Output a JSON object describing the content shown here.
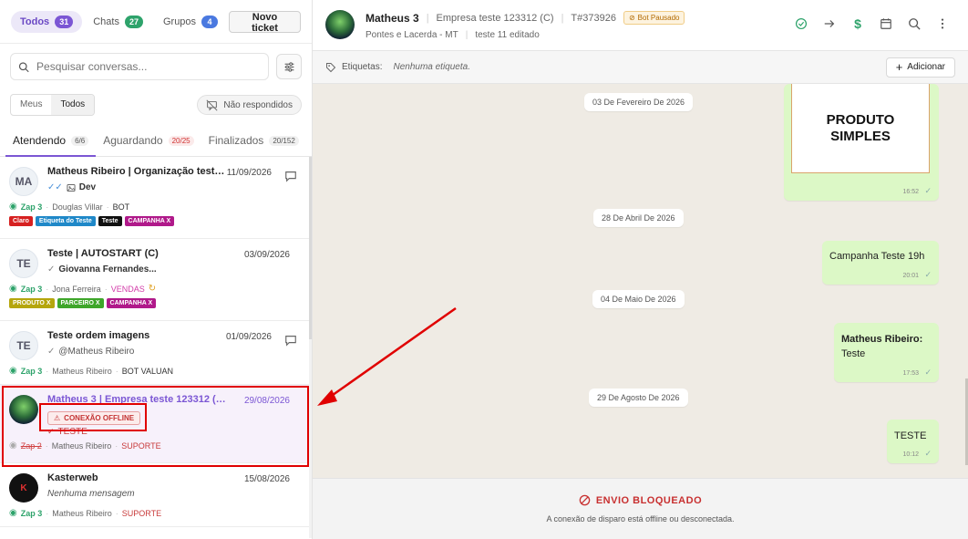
{
  "top_tabs": [
    {
      "label": "Todos",
      "count": "31"
    },
    {
      "label": "Chats",
      "count": "27"
    },
    {
      "label": "Grupos",
      "count": "4"
    }
  ],
  "new_ticket_label": "Novo ticket",
  "search": {
    "placeholder": "Pesquisar conversas..."
  },
  "segment": {
    "meus": "Meus",
    "todos": "Todos"
  },
  "nao_respondidos": "Não respondidos",
  "status_tabs": [
    {
      "label": "Atendendo",
      "count": "6/6"
    },
    {
      "label": "Aguardando",
      "count": "20/25"
    },
    {
      "label": "Finalizados",
      "count": "20/152"
    }
  ],
  "tickets": [
    {
      "initials": "MA",
      "title": "Matheus Ribeiro | Organização teste (C)",
      "date": "11/09/2026",
      "last_message": "Dev",
      "connection": "Zap 3",
      "user": "Douglas Villar",
      "queue": "BOT",
      "tags": [
        {
          "label": "Claro",
          "color": "#d62020"
        },
        {
          "label": "Etiqueta do Teste",
          "color": "#1f88c8"
        },
        {
          "label": "Teste",
          "color": "#111111"
        },
        {
          "label": "CAMPANHA X",
          "color": "#b0198a"
        }
      ]
    },
    {
      "initials": "TE",
      "title": "Teste | AUTOSTART (C)",
      "date": "03/09/2026",
      "last_message": "Giovanna Fernandes...",
      "connection": "Zap 3",
      "user": "Jona Ferreira",
      "queue": "VENDAS",
      "tags": [
        {
          "label": "PRODUTO X",
          "color": "#b5a60c"
        },
        {
          "label": "PARCEIRO X",
          "color": "#3ea62a"
        },
        {
          "label": "CAMPANHA X",
          "color": "#b0198a"
        }
      ]
    },
    {
      "initials": "TE",
      "title": "Teste ordem imagens",
      "date": "01/09/2026",
      "last_message": "@Matheus Ribeiro",
      "connection": "Zap 3",
      "user": "Matheus Ribeiro",
      "queue": "BOT VALUAN"
    },
    {
      "title": "Matheus 3 | Empresa teste 123312 (C)",
      "date": "29/08/2026",
      "offline_badge": "CONEXÃO OFFLINE",
      "last_message": "TESTE",
      "connection": "Zap 2",
      "user": "Matheus Ribeiro",
      "queue": "SUPORTE"
    },
    {
      "title": "Kasterweb",
      "date": "15/08/2026",
      "last_message": "Nenhuma mensagem",
      "connection": "Zap 3",
      "user": "Matheus Ribeiro",
      "queue": "SUPORTE"
    }
  ],
  "chat": {
    "name": "Matheus 3",
    "company": "Empresa teste 123312 (C)",
    "ticket": "T#373926",
    "bot_status": "Bot Pausado",
    "location": "Pontes e Lacerda - MT",
    "note": "teste 11 editado",
    "tags_label": "Etiquetas:",
    "tags_none": "Nenhuma etiqueta.",
    "add_label": "Adicionar"
  },
  "messages": {
    "d1": "03 De Fevereiro De 2026",
    "product_text": "PRODUTO SIMPLES",
    "t1": "16:52",
    "d2": "28 De Abril De 2026",
    "m2": "Campanha Teste 19h",
    "t2": "20:01",
    "d3": "04 De Maio De 2026",
    "m3_author": "Matheus Ribeiro:",
    "m3_text": "Teste",
    "t3": "17:53",
    "d4": "29 De Agosto De 2026",
    "m4": "TESTE",
    "t4": "10:12"
  },
  "blocked": {
    "title": "ENVIO BLOQUEADO",
    "subtitle": "A conexão de disparo está offline ou desconectada."
  },
  "colors": {
    "accent": "#7b56d4",
    "whatsapp": "#2ea36b",
    "danger": "#c83030",
    "bubble": "#dcf8c6"
  }
}
